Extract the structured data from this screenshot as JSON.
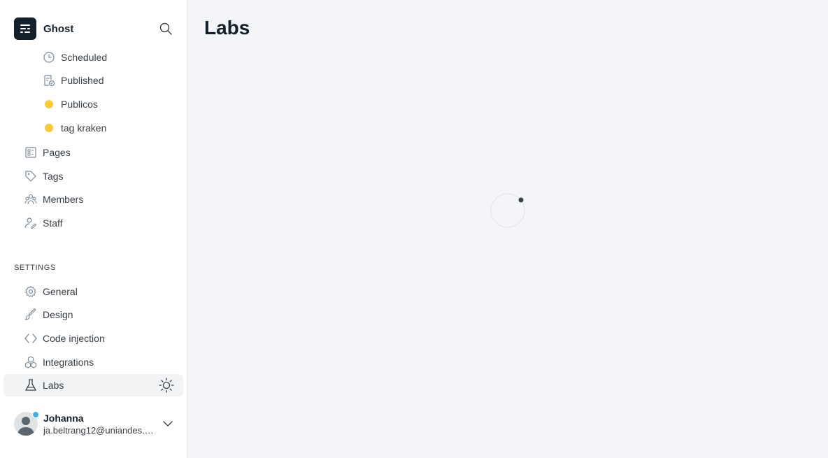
{
  "brand": {
    "name": "Ghost",
    "icon": "ghost-logo-icon"
  },
  "search": {
    "icon": "search-icon"
  },
  "nav": {
    "sub_items": [
      {
        "label": "Scheduled",
        "icon": "clock-icon"
      },
      {
        "label": "Published",
        "icon": "published-doc-icon"
      },
      {
        "label": "Publicos",
        "icon": "tag-dot-icon",
        "color": "#fdc935"
      },
      {
        "label": "tag kraken",
        "icon": "tag-dot-icon",
        "color": "#fdc935"
      }
    ],
    "items": [
      {
        "label": "Pages",
        "icon": "pages-icon"
      },
      {
        "label": "Tags",
        "icon": "tag-icon"
      },
      {
        "label": "Members",
        "icon": "members-icon"
      },
      {
        "label": "Staff",
        "icon": "staff-icon"
      }
    ]
  },
  "settings": {
    "title": "SETTINGS",
    "items": [
      {
        "label": "General",
        "icon": "gear-icon"
      },
      {
        "label": "Design",
        "icon": "brush-icon"
      },
      {
        "label": "Code injection",
        "icon": "code-icon"
      },
      {
        "label": "Integrations",
        "icon": "integrations-icon"
      },
      {
        "label": "Labs",
        "icon": "flask-icon",
        "active": true
      }
    ]
  },
  "theme_toggle": {
    "icon": "sun-icon"
  },
  "user": {
    "name": "Johanna",
    "email": "ja.beltrang12@uniandes.e...",
    "status_color": "#3eb0ef"
  },
  "main": {
    "title": "Labs",
    "loading": true
  },
  "colors": {
    "accent_tag": "#fdc935",
    "sidebar_bg": "#ffffff",
    "main_bg": "#f4f5f8",
    "text": "#15212a"
  }
}
